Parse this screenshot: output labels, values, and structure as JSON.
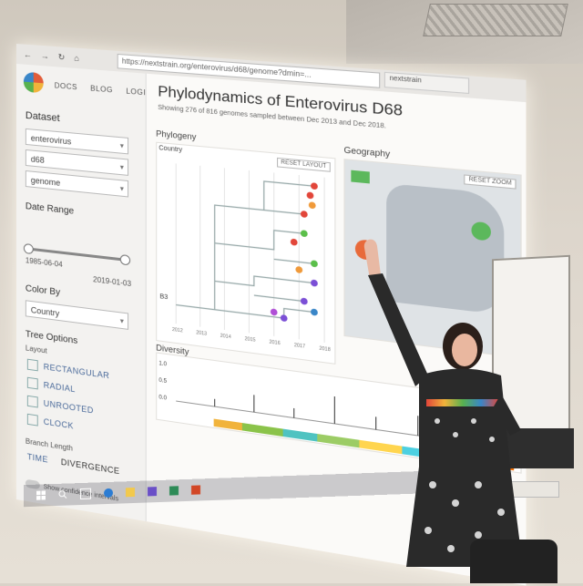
{
  "browser": {
    "url": "https://nextstrain.org/enterovirus/d68/genome?dmin=...",
    "tabs": [
      "nextstrain",
      "nextstrain",
      "nextstrain"
    ]
  },
  "nav": {
    "links": [
      "DOCS",
      "BLOG",
      "LOGIN"
    ]
  },
  "sidebar": {
    "dataset_heading": "Dataset",
    "dataset_values": [
      "enterovirus",
      "d68",
      "genome"
    ],
    "date_range_heading": "Date Range",
    "date_start": "1985-06-04",
    "date_end": "2019-01-03",
    "color_by_heading": "Color By",
    "color_by_value": "Country",
    "tree_options_heading": "Tree Options",
    "layout_label": "Layout",
    "layouts": [
      "RECTANGULAR",
      "RADIAL",
      "UNROOTED",
      "CLOCK"
    ],
    "branch_length_label": "Branch Length",
    "branch_options": [
      "TIME",
      "DIVERGENCE"
    ],
    "confidence_label": "Show confidence intervals"
  },
  "main": {
    "title": "Phylodynamics of Enterovirus D68",
    "subtitle": "Showing 276 of 816 genomes sampled between Dec 2013 and Dec 2018.",
    "phylogeny_label": "Phylogeny",
    "country_label": "Country",
    "reset_layout": "RESET LAYOUT",
    "geography_label": "Geography",
    "reset_zoom": "RESET ZOOM",
    "diversity_label": "Diversity",
    "tree_axis": [
      "2012",
      "2013",
      "2014",
      "2015",
      "2016",
      "2017",
      "2018"
    ],
    "diversity_ticks": [
      "1.0",
      "0.5",
      "0.0"
    ],
    "clade_label": "B3"
  },
  "colors": {
    "accent": "#4a6a9a",
    "tree_red": "#e2463a",
    "tree_green": "#5bbf4a",
    "tree_purple": "#7b4fd6",
    "tree_orange": "#f09a3a",
    "map_green": "#5cb85c"
  },
  "icons": [
    "back-icon",
    "forward-icon",
    "refresh-icon",
    "home-icon",
    "nextstrain-logo",
    "search-icon",
    "task-view-icon",
    "edge-icon",
    "folder-icon",
    "outlook-icon",
    "excel-icon",
    "powerpoint-icon"
  ]
}
